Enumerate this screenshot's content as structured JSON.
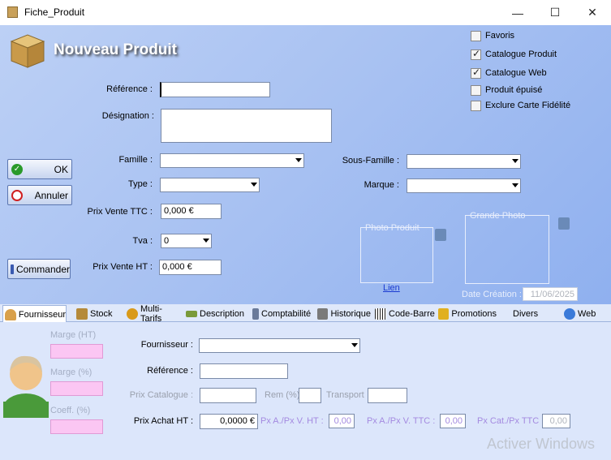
{
  "window": {
    "title": "Fiche_Produit",
    "minimize": "—",
    "maximize": "☐",
    "close": "✕"
  },
  "header": {
    "title": "Nouveau Produit"
  },
  "options": [
    {
      "label": "Favoris",
      "checked": false
    },
    {
      "label": "Catalogue Produit",
      "checked": true
    },
    {
      "label": "Catalogue Web",
      "checked": true
    },
    {
      "label": "Produit épuisé",
      "checked": false
    },
    {
      "label": "Exclure Carte Fidélité",
      "checked": false
    }
  ],
  "form": {
    "reference_label": "Référence :",
    "reference_value": "",
    "designation_label": "Désignation :",
    "designation_value": "",
    "famille_label": "Famille :",
    "famille_value": "",
    "sous_famille_label": "Sous-Famille :",
    "sous_famille_value": "",
    "type_label": "Type :",
    "type_value": "",
    "marque_label": "Marque :",
    "marque_value": "",
    "prix_ttc_label": "Prix Vente TTC :",
    "prix_ttc_value": "0,000 €",
    "tva_label": "Tva :",
    "tva_value": "0",
    "prix_ht_label": "Prix Vente HT :",
    "prix_ht_value": "0,000 €"
  },
  "buttons": {
    "ok": "OK",
    "annuler": "Annuler",
    "commander": "Commander"
  },
  "photos": {
    "photo_produit": "Photo Produit",
    "grande_photo": "Grande Photo",
    "lien": "Lien",
    "date_creation_label": "Date Création :",
    "date_creation_value": "11/06/2025"
  },
  "tabs": [
    {
      "label": "Fournisseur",
      "icon": "person-icon",
      "color": "#d9a04a"
    },
    {
      "label": "Stock",
      "icon": "box-icon",
      "color": "#b58a3a"
    },
    {
      "label": "Multi-Tarifs",
      "icon": "coins-icon",
      "color": "#d99a1a"
    },
    {
      "label": "Description",
      "icon": "pencil-icon",
      "color": "#7a9a3a"
    },
    {
      "label": "Comptabilité",
      "icon": "phone-icon",
      "color": "#6a7a9a"
    },
    {
      "label": "Historique",
      "icon": "gear-icon",
      "color": "#7a7a7a"
    },
    {
      "label": "Code-Barre",
      "icon": "barcode-icon",
      "color": "#222222"
    },
    {
      "label": "Promotions",
      "icon": "tag-icon",
      "color": "#e0b020"
    },
    {
      "label": "Divers",
      "icon": "",
      "color": ""
    },
    {
      "label": "Web",
      "icon": "globe-icon",
      "color": "#3a7ad9"
    }
  ],
  "supplier": {
    "marge_ht_label": "Marge (HT)",
    "marge_pct_label": "Marge (%)",
    "coeff_label": "Coeff. (%)",
    "fournisseur_label": "Fournisseur :",
    "fournisseur_value": "",
    "reference_label": "Référence :",
    "reference_value": "",
    "prix_catalogue_label": "Prix Catalogue :",
    "prix_catalogue_value": "",
    "rem_label": "Rem (%)",
    "rem_value": "",
    "transport_label": "Transport",
    "transport_value": "",
    "prix_achat_label": "Prix Achat HT :",
    "prix_achat_value": "0,0000 €",
    "pxa_pxv_ht_label": "Px A./Px V. HT :",
    "pxa_pxv_ht_value": "0,00",
    "pxa_pxv_ttc_label": "Px A./Px V. TTC :",
    "pxa_pxv_ttc_value": "0,00",
    "pxcat_label": "Px Cat./Px TTC",
    "pxcat_value": "0,00"
  },
  "watermark": "Activer Windows"
}
